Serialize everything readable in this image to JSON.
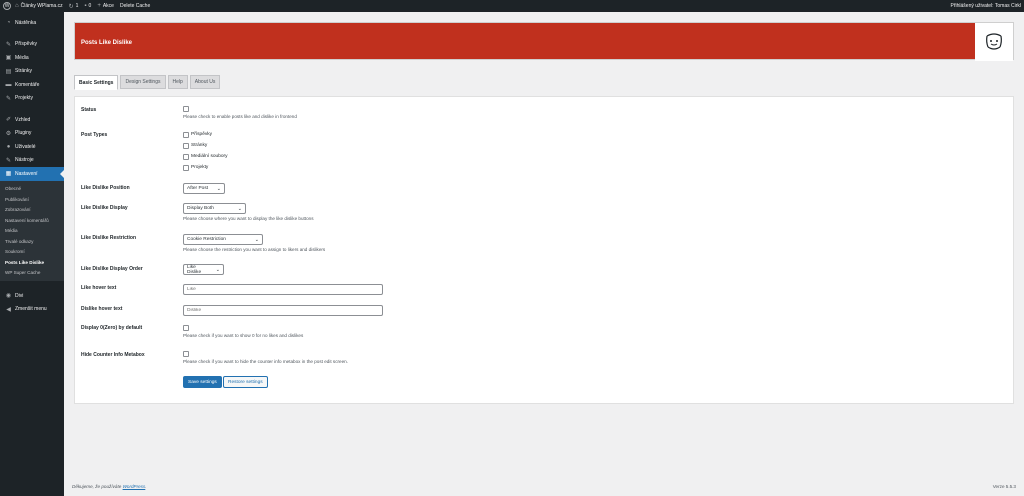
{
  "adminbar": {
    "site_name": "Články WPlama.cz",
    "updates_count": "1",
    "comments_count": "0",
    "new_label": "Akce",
    "delete_cache": "Delete Cache",
    "greeting": "Přihlášený uživatel: Tomas Cirkl"
  },
  "sidebar": {
    "items_top": [
      {
        "icon": "dashboard-icon",
        "glyph": "◔",
        "label": "Nástěnka"
      }
    ],
    "items_content": [
      {
        "icon": "pin-icon",
        "glyph": "✎",
        "label": "Příspěvky"
      },
      {
        "icon": "media-icon",
        "glyph": "▣",
        "label": "Média"
      },
      {
        "icon": "pages-icon",
        "glyph": "▤",
        "label": "Stránky"
      },
      {
        "icon": "comments-icon",
        "glyph": "▬",
        "label": "Komentáře"
      },
      {
        "icon": "projects-icon",
        "glyph": "✎",
        "label": "Projekty"
      }
    ],
    "items_admin": [
      {
        "icon": "appearance-icon",
        "glyph": "✐",
        "label": "Vzhled"
      },
      {
        "icon": "plugins-icon",
        "glyph": "⚙",
        "label": "Pluginy"
      },
      {
        "icon": "users-icon",
        "glyph": "●",
        "label": "Uživatelé"
      },
      {
        "icon": "tools-icon",
        "glyph": "✎",
        "label": "Nástroje"
      }
    ],
    "current": {
      "icon": "settings-icon",
      "glyph": "▦",
      "label": "Nastavení"
    },
    "submenu": [
      "Obecné",
      "Publikování",
      "Zobrazování",
      "Nastavení komentářů",
      "Média",
      "Trvalé odkazy",
      "Soukromí",
      "Posts Like Dislike",
      "WP Super Cache"
    ],
    "submenu_current_index": 7,
    "items_bottom": [
      {
        "icon": "divi-icon",
        "glyph": "◉",
        "label": "Divi"
      },
      {
        "icon": "collapse-icon",
        "glyph": "◀",
        "label": "Zmenšit menu"
      }
    ]
  },
  "page": {
    "title": "Posts Like Dislike",
    "tabs": [
      "Basic Settings",
      "Design Settings",
      "Help",
      "About Us"
    ],
    "active_tab": 0
  },
  "settings": {
    "status": {
      "label": "Status",
      "desc": "Please check to enable posts like and dislike in frontend"
    },
    "post_types": {
      "label": "Post Types",
      "options": [
        "Příspěvky",
        "Stránky",
        "Mediální soubory",
        "Projekty"
      ]
    },
    "position": {
      "label": "Like Dislike Position",
      "value": "After Post"
    },
    "display": {
      "label": "Like Dislike Display",
      "value": "Display Both",
      "desc": "Please choose where you want to display the like dislike buttons"
    },
    "restriction": {
      "label": "Like Dislike Restriction",
      "value": "Cookie Restriction",
      "desc": "Please choose the restriction you want to assign to likers and dislikers"
    },
    "order": {
      "label": "Like Dislike Display Order",
      "value": "Like Dislike"
    },
    "like_hover": {
      "label": "Like hover text",
      "placeholder": "Like"
    },
    "dislike_hover": {
      "label": "Dislike hover text",
      "placeholder": "Dislike"
    },
    "display_zero": {
      "label": "Display 0(Zero) by default",
      "desc": "Please check if you want to show 0 for no likes and dislikes"
    },
    "hide_counter": {
      "label": "Hide Counter Info Metabox",
      "desc": "Please check if you want to hide the counter info metabox in the post edit screen."
    },
    "save_label": "Save settings",
    "restore_label": "Restore settings"
  },
  "footer": {
    "thanks_prefix": "Děkujeme, že používáte",
    "thanks_link": "WordPress",
    "thanks_suffix": ".",
    "version": "Verze 5.5.3"
  },
  "colors": {
    "hero": "#c0301e",
    "accent": "#2271b1",
    "sidebar": "#1d2327"
  }
}
